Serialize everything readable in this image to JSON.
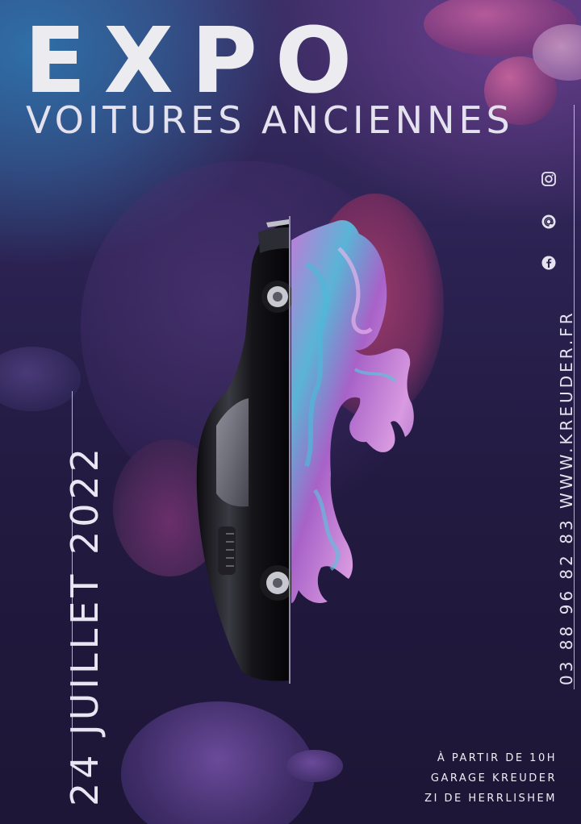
{
  "poster": {
    "title": "EXPO",
    "subtitle": "VOITURES ANCIENNES",
    "date": "24 JUILLET 2022",
    "contact": "03 88 96 82 83 WWW.KREUDER.FR",
    "info": {
      "time": "À PARTIR DE 10H",
      "venue": "GARAGE KREUDER",
      "address": "ZI DE HERRLISHEM"
    },
    "social_icons": [
      "instagram-icon",
      "at-icon",
      "facebook-icon"
    ]
  },
  "colors": {
    "background": "#221a40",
    "text": "#ececf0",
    "accent_blue": "#2f6fa8",
    "accent_purple": "#9a6ad0",
    "accent_pink": "#9a3b6b"
  }
}
